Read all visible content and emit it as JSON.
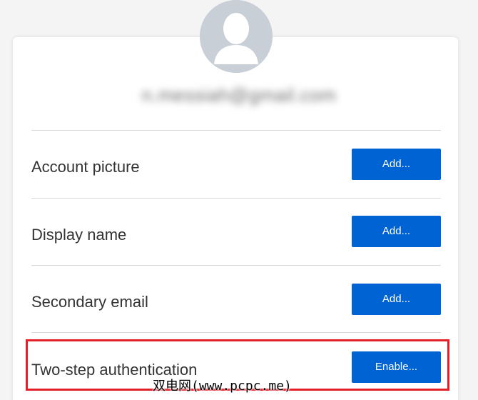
{
  "account": {
    "email": "n.messiah@gmail.com"
  },
  "rows": [
    {
      "label": "Account picture",
      "button_label": "Add..."
    },
    {
      "label": "Display name",
      "button_label": "Add..."
    },
    {
      "label": "Secondary email",
      "button_label": "Add..."
    },
    {
      "label": "Two-step authentication",
      "button_label": "Enable..."
    }
  ],
  "colors": {
    "button": "#0063d3",
    "highlight": "#e22028",
    "avatar_bg": "#c8cfd6"
  },
  "icons": {
    "avatar": "user-silhouette-icon"
  },
  "watermark": {
    "text": "双电网(www.pcpc.me)"
  }
}
